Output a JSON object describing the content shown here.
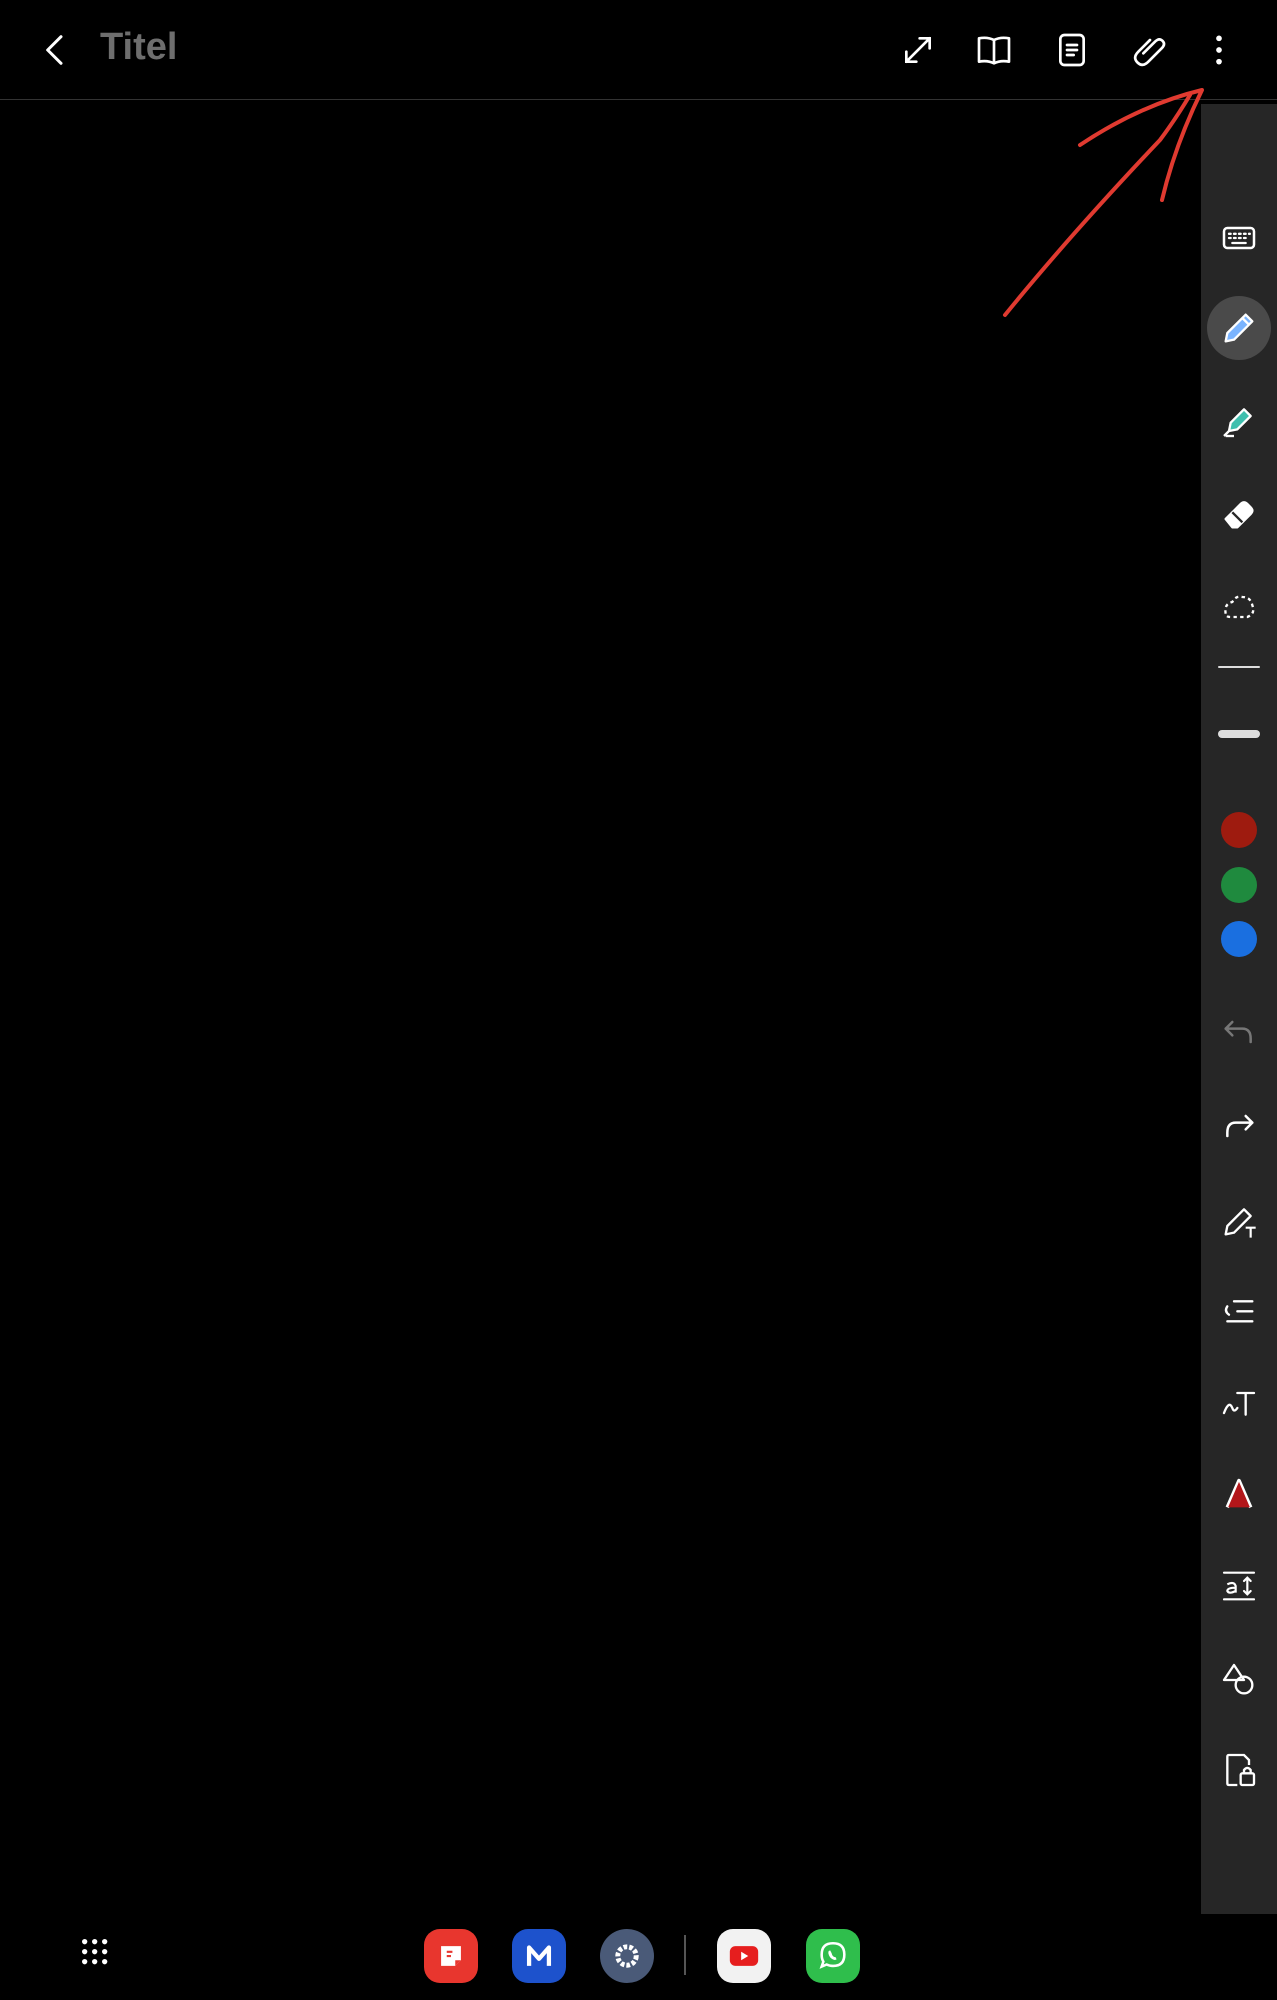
{
  "header": {
    "title": "Titel",
    "icons": [
      "back-arrow-icon",
      "fullscreen-icon",
      "book-icon",
      "page-icon",
      "attachment-icon",
      "more-icon"
    ]
  },
  "toolbar": {
    "tools": [
      "keyboard-icon",
      "pen-icon",
      "highlighter-icon",
      "eraser-icon",
      "lasso-icon",
      "thin-line",
      "thick-line",
      "red-color",
      "green-color",
      "blue-color",
      "undo-icon",
      "redo-icon",
      "pen-text-icon",
      "align-icon",
      "handwriting-icon",
      "text-style-icon",
      "text-size-icon",
      "shapes-icon",
      "lock-icon"
    ],
    "colors": {
      "red": "#9e1b0f",
      "green": "#1f8a3e",
      "blue": "#1a6fe0",
      "accent_pen": "#7ab4ff"
    }
  },
  "annotation": {
    "color": "#e03a30"
  },
  "dock": {
    "apps": [
      "notes-app",
      "mail-app",
      "settings-app",
      "youtube-app",
      "whatsapp-app"
    ]
  }
}
